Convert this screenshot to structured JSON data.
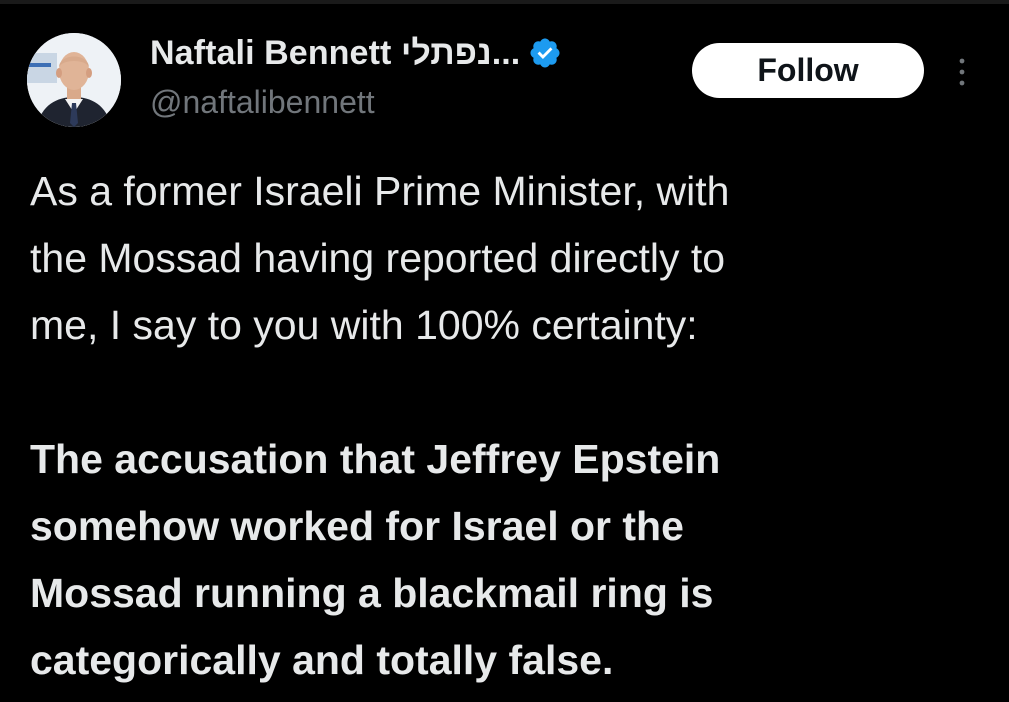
{
  "tweet": {
    "author": {
      "display_name": "Naftali Bennett נפתלי...",
      "handle": "@naftalibennett",
      "verified_icon": "verified-badge-icon",
      "avatar_icon": "profile-photo"
    },
    "follow_label": "Follow",
    "more_icon": "more-options-icon",
    "paragraphs": [
      {
        "lines": [
          "As a former Israeli Prime Minister, with",
          "the Mossad having reported directly to",
          "me, I say to you with 100% certainty:"
        ]
      },
      {
        "lines": [
          "The accusation that Jeffrey Epstein",
          "somehow worked for Israel or the",
          "Mossad running a blackmail ring is",
          "categorically and totally false."
        ]
      }
    ]
  },
  "colors": {
    "background": "#000000",
    "text_primary": "#e7e9ea",
    "text_secondary": "#71767b",
    "verified_blue": "#1d9bf0",
    "follow_bg": "#ffffff"
  }
}
